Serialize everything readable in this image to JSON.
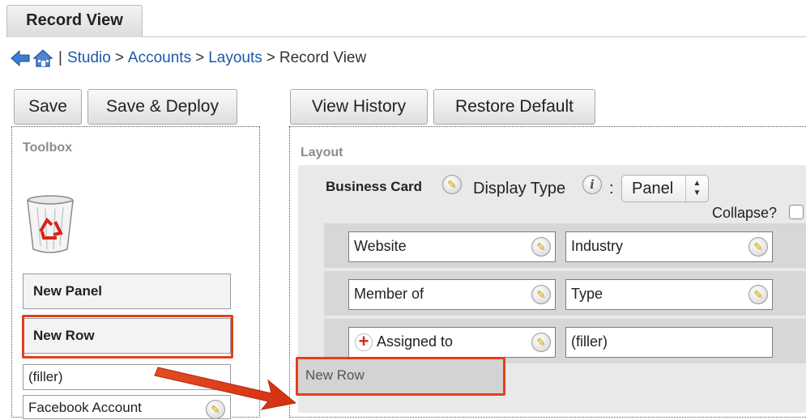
{
  "tab": {
    "label": "Record View"
  },
  "breadcrumb": {
    "pipe": "|",
    "studio": "Studio",
    "sep1": ">",
    "accounts": "Accounts",
    "sep2": ">",
    "layouts": "Layouts",
    "sep3": ">",
    "current": "Record View"
  },
  "toolbar_left": {
    "save": "Save",
    "save_deploy": "Save & Deploy"
  },
  "toolbar_right": {
    "view_history": "View History",
    "restore_default": "Restore Default"
  },
  "toolbox": {
    "title": "Toolbox",
    "new_panel": "New Panel",
    "new_row": "New Row",
    "filler": "(filler)",
    "facebook": "Facebook Account"
  },
  "layout": {
    "title": "Layout",
    "panel_name": "Business Card",
    "display_type_label": "Display Type",
    "colon": ":",
    "display_type_value": "Panel",
    "collapse_label": "Collapse?",
    "rows": [
      {
        "left": "Website",
        "right": "Industry"
      },
      {
        "left": "Member of",
        "right": "Type"
      },
      {
        "left": "Assigned to",
        "right": "(filler)"
      }
    ],
    "drop_new_row": "New Row"
  },
  "colors": {
    "highlight": "#e2401c",
    "link": "#1d58a8"
  }
}
